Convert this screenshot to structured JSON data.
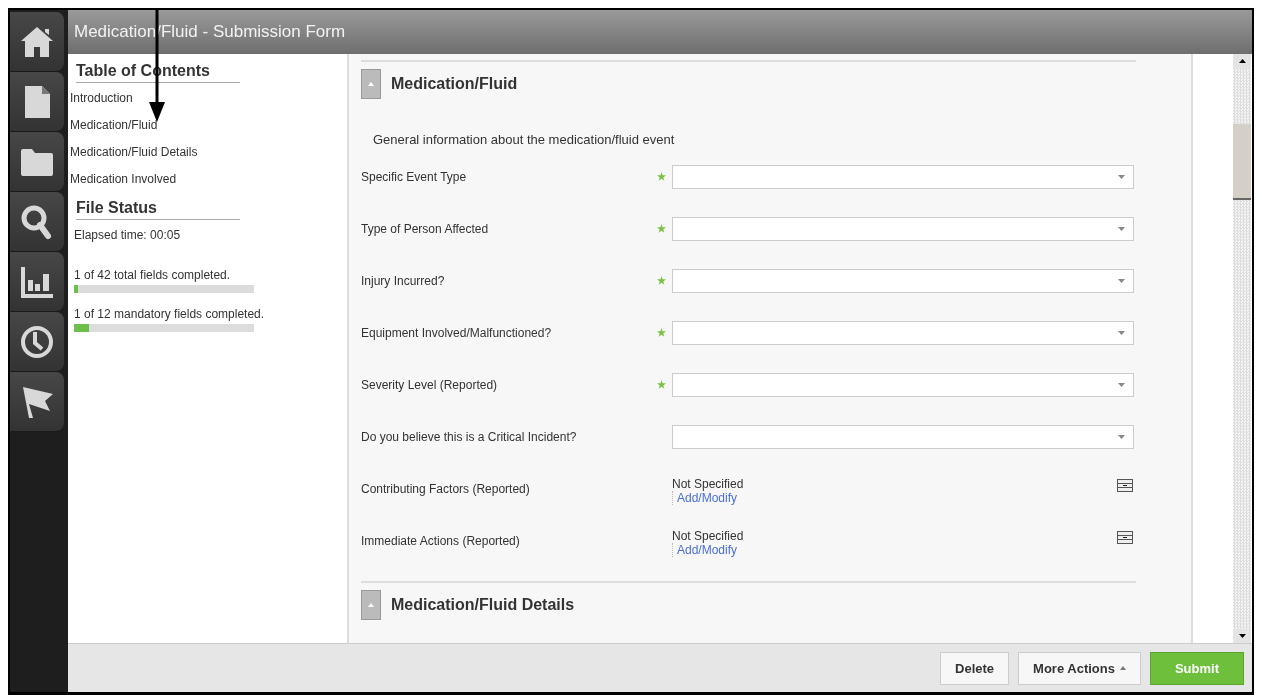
{
  "window": {
    "title": "Medication/Fluid - Submission Form"
  },
  "table_of_contents": {
    "heading": "Table of Contents",
    "items": [
      {
        "label": "Introduction"
      },
      {
        "label": "Medication/Fluid"
      },
      {
        "label": "Medication/Fluid Details"
      },
      {
        "label": "Medication Involved"
      }
    ]
  },
  "file_status": {
    "heading": "File Status",
    "elapsed": "Elapsed time: 00:05",
    "progress": [
      {
        "label": "1 of 42 total fields completed.",
        "level": 0.024
      },
      {
        "label": "1 of 12 mandatory fields completed.",
        "level": 0.083
      }
    ]
  },
  "sections": [
    {
      "title": "Medication/Fluid",
      "expanded": true,
      "description": "General information about the medication/fluid event",
      "fields": [
        {
          "kind": "dropdown",
          "label": "Specific Event Type",
          "required": true
        },
        {
          "kind": "dropdown",
          "label": "Type of Person Affected",
          "required": true
        },
        {
          "kind": "dropdown",
          "label": "Injury Incurred?",
          "required": true
        },
        {
          "kind": "dropdown",
          "label": "Equipment Involved/Malfunctioned?",
          "required": true
        },
        {
          "kind": "dropdown",
          "label": "Severity Level (Reported)",
          "required": true
        },
        {
          "kind": "dropdown",
          "label": "Do you believe this is a Critical Incident?",
          "required": false
        },
        {
          "kind": "multi",
          "label": "Contributing Factors (Reported)",
          "value": "Not Specified",
          "link": "Add/Modify"
        },
        {
          "kind": "multi",
          "label": "Immediate Actions (Reported)",
          "value": "Not Specified",
          "link": "Add/Modify"
        }
      ]
    },
    {
      "title": "Medication/Fluid Details",
      "expanded": true
    }
  ],
  "buttons": [
    {
      "label": "Delete",
      "kind": "plain"
    },
    {
      "label": "More Actions",
      "kind": "menu"
    },
    {
      "label": "Submit",
      "kind": "primary"
    }
  ]
}
